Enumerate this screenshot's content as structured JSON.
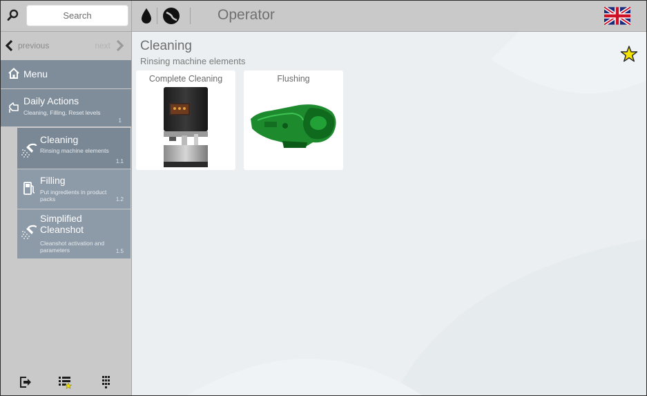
{
  "search": {
    "placeholder": "Search"
  },
  "nav": {
    "previous_label": "previous",
    "next_label": "next"
  },
  "menu": {
    "label": "Menu"
  },
  "section": {
    "title": "Daily Actions",
    "subtitle": "Cleaning, Filling, Reset levels",
    "number": "1"
  },
  "sub_items": [
    {
      "title": "Cleaning",
      "desc": "Rinsing machine elements",
      "number": "1.1",
      "icon": "shower-icon",
      "selected": true
    },
    {
      "title": "Filling",
      "desc": "Put ingredients in product packs",
      "number": "1.2",
      "icon": "fuel-pump-icon",
      "selected": false
    },
    {
      "title": "Simplified Cleanshot",
      "desc": "Cleanshot activation and parameters",
      "number": "1.5",
      "icon": "shower-icon",
      "selected": false
    }
  ],
  "header": {
    "title": "Operator",
    "language": "English (UK flag)"
  },
  "page": {
    "title": "Cleaning",
    "subtitle": "Rinsing machine elements"
  },
  "cards": [
    {
      "label": "Complete Cleaning",
      "image": "coffee-machine"
    },
    {
      "label": "Flushing",
      "image": "green-brewing-unit"
    }
  ],
  "colors": {
    "sidebar_bg": "#c9c9c9",
    "nav_item_bg": "#7f8d9b",
    "sub_item_bg": "#8d9aa7",
    "selected_item_bg": "#7a8896",
    "main_bg": "#ebeff1",
    "favorite_star": "#f5e400"
  }
}
